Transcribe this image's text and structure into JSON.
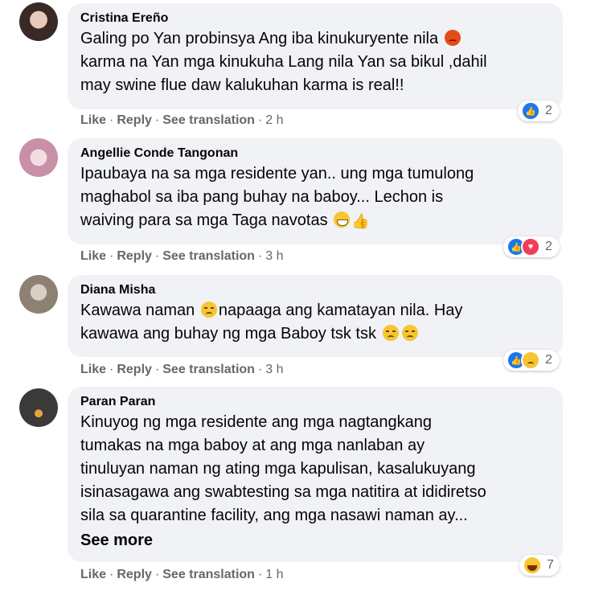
{
  "actions": {
    "like": "Like",
    "reply": "Reply",
    "see_translation": "See translation"
  },
  "comments": [
    {
      "name": "Cristina Ereño",
      "lines": [
        "Galing po Yan probinsya Ang iba kinukuryente nila",
        "karma na Yan mga kinukuha Lang nila Yan sa bikul ,dahil",
        "may swine flue daw kalukuhan karma is real!!"
      ],
      "time": "2 h",
      "reaction_count": "2",
      "reactions": [
        "like"
      ]
    },
    {
      "name": "Angellie Conde Tangonan",
      "lines": [
        "Ipaubaya na sa mga residente yan.. ung mga tumulong",
        "maghabol sa iba pang buhay na baboy... Lechon is",
        "waiving para sa mga Taga navotas"
      ],
      "time": "3 h",
      "reaction_count": "2",
      "reactions": [
        "like",
        "love"
      ]
    },
    {
      "name": "Diana Misha",
      "lines": [
        "Kawawa naman",
        "napaaga ang kamatayan nila. Hay",
        "kawawa ang buhay ng mga Baboy tsk tsk"
      ],
      "time": "3 h",
      "reaction_count": "2",
      "reactions": [
        "like",
        "sad"
      ]
    },
    {
      "name": "Paran Paran",
      "lines": [
        "Kinuyog ng mga residente ang mga nagtangkang",
        "tumakas na mga baboy at ang mga nanlaban ay",
        "tinuluyan naman ng ating mga kapulisan, kasalukuyang",
        "isinasagawa ang swabtesting sa mga natitira at ididiretso",
        "sila sa quarantine facility, ang mga nasawi naman ay..."
      ],
      "see_more": "See more",
      "time": "1 h",
      "reaction_count": "7",
      "reactions": [
        "haha"
      ]
    }
  ]
}
